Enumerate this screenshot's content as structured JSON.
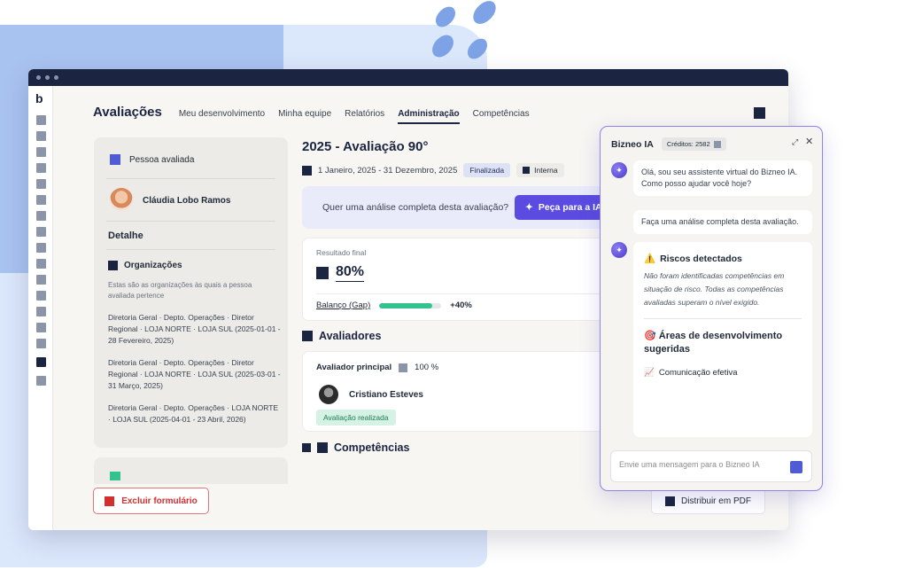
{
  "nav": {
    "title": "Avaliações",
    "items": [
      {
        "label": "Meu desenvolvimento"
      },
      {
        "label": "Minha equipe"
      },
      {
        "label": "Relatórios"
      },
      {
        "label": "Administração"
      },
      {
        "label": "Competências"
      }
    ],
    "active": "Administração"
  },
  "sidebar": {
    "logo": "b",
    "active_index": 16
  },
  "person": {
    "header": "Pessoa avaliada",
    "name": "Cláudia Lobo Ramos",
    "detail_title": "Detalhe",
    "orgs_title": "Organizações",
    "orgs_desc": "Estas são as organizações às quais a pessoa avaliada pertence",
    "entries": [
      "Diretoria Geral · Depto. Operações · Diretor Regional · LOJA NORTE · LOJA SUL (2025-01-01 - 28 Fevereiro, 2025)",
      "Diretoria Geral · Depto. Operações · Diretor Regional · LOJA NORTE · LOJA SUL (2025-03-01 - 31 Março, 2025)",
      "Diretoria Geral · Depto. Operações · LOJA NORTE · LOJA SUL (2025-04-01 - 23 Abril, 2026)"
    ]
  },
  "evaluation": {
    "title": "2025 - Avaliação 90°",
    "period": "1 Janeiro, 2025 - 31 Dezembro, 2025",
    "status": "Finalizada",
    "type": "Interna",
    "ia_question": "Quer uma análise completa desta avaliação?",
    "ia_button": "Peça para a IA",
    "result_label": "Resultado final",
    "result_value": "80%",
    "gap_label": "Balanço (Gap)",
    "gap_fraction": 0.85,
    "gap_value": "+40%",
    "evaluators_title": "Avaliadores",
    "evaluator_role": "Avaliador principal",
    "evaluator_weight": "100 %",
    "evaluator_name": "Cristiano Esteves",
    "evaluator_status": "Avaliação realizada",
    "competencies_title": "Competências"
  },
  "buttons": {
    "delete": "Excluir formulário",
    "pdf": "Distribuir em PDF"
  },
  "chat": {
    "title": "Bizneo IA",
    "credits": "Créditos: 2582",
    "greeting": "Olá, sou seu assistente virtual do Bizneo IA. Como posso ajudar você hoje?",
    "user_msg": "Faça uma análise completa desta avaliação.",
    "risk_icon": "⚠️",
    "risk_title": "Riscos detectados",
    "risk_text": "Não foram identificadas competências em situação de risco. Todas as competências avaliadas superam o nível exigido.",
    "areas_icon": "🎯",
    "areas_title": "Áreas de desenvolvimento sugeridas",
    "area_item_icon": "📈",
    "area_item": "Comunicação efetiva",
    "input_placeholder": "Envie uma mensagem para o Bizneo IA"
  },
  "colors": {
    "navy": "#1b2440",
    "accent_purple": "#5b4be0",
    "success": "#34c38f",
    "danger": "#d32f2f"
  }
}
